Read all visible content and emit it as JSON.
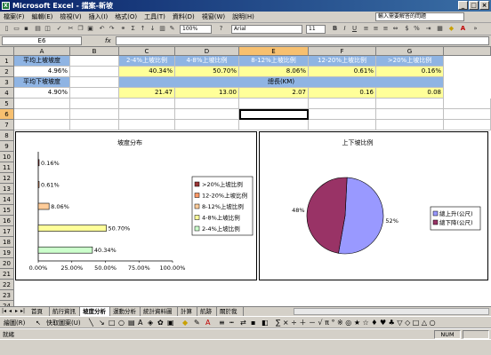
{
  "window": {
    "title": "Microsoft Excel - 擋案-新坡",
    "app_icon": "excel-icon"
  },
  "menu": {
    "items": [
      "檔案(F)",
      "編輯(E)",
      "檢視(V)",
      "插入(I)",
      "格式(O)",
      "工具(T)",
      "資料(D)",
      "視窗(W)",
      "說明(H)"
    ],
    "ask_placeholder": "輸入需要解答的問題"
  },
  "toolbar": {
    "zoom": "100%",
    "font": "Arial",
    "size": "11"
  },
  "formula": {
    "namebox": "E6",
    "fx": "fx"
  },
  "columns": [
    "A",
    "B",
    "C",
    "D",
    "E",
    "F",
    "G"
  ],
  "rows": [
    "1",
    "2",
    "3",
    "4",
    "5",
    "6",
    "7",
    "8",
    "9",
    "10",
    "11",
    "12",
    "13",
    "14",
    "15",
    "16",
    "17",
    "18",
    "19",
    "20",
    "21",
    "22",
    "23",
    "24",
    "25",
    "26"
  ],
  "cells": {
    "a1": "平均上坡坡度",
    "a2": "4.96%",
    "a3": "平均下坡坡度",
    "a4": "4.90%",
    "c1": "2-4%上坡比例",
    "d1": "4-8%上坡比例",
    "e1": "8-12%上坡比例",
    "f1": "12-20%上坡比例",
    "g1": ">20%上坡比例",
    "c2": "40.34%",
    "d2": "50.70%",
    "e2": "8.06%",
    "f2": "0.61%",
    "g2": "0.16%",
    "total_label": "總長(KM)",
    "c4": "21.47",
    "d4": "13.00",
    "e4": "2.07",
    "f4": "0.16",
    "g4": "0.08"
  },
  "chart_data": [
    {
      "type": "bar",
      "title": "坡度分布",
      "categories": [
        "2-4%上坡比例",
        "4-8%上坡比例",
        "8-12%上坡比例",
        "12-20%上坡比例",
        ">20%上坡比例"
      ],
      "values": [
        40.34,
        50.7,
        8.06,
        0.61,
        0.16
      ],
      "labels": [
        "40.34%",
        "50.70%",
        "8.06%",
        "0.61%",
        "0.16%"
      ],
      "colors": [
        "#ccffcc",
        "#ffff99",
        "#ffcc99",
        "#ff9966",
        "#993333"
      ],
      "xticks": [
        "0.00%",
        "25.00%",
        "50.00%",
        "75.00%",
        "100.00%"
      ],
      "xlim": [
        0,
        100
      ],
      "legend": "right",
      "legend_order": [
        ">20%上坡比例",
        "12-20%上坡比例",
        "8-12%上坡比例",
        "4-8%上坡比例",
        "2-4%上坡比例"
      ]
    },
    {
      "type": "pie",
      "title": "上下坡比例",
      "series": [
        {
          "name": "總上升(公尺)",
          "value": 52,
          "label": "52%",
          "color": "#9999ff"
        },
        {
          "name": "總下降(公尺)",
          "value": 48,
          "label": "48%",
          "color": "#993366"
        }
      ],
      "legend": "right"
    }
  ],
  "tabs": [
    "首頁",
    "航行資訊",
    "坡度分析",
    "運動分析",
    "統計資料圖",
    "計算",
    "航跡",
    "關於我"
  ],
  "active_tab": "坡度分析",
  "drawbar": {
    "draw_label": "繪圖(R)",
    "autoshape_label": "快取圖案(U)"
  },
  "status": {
    "left": "就緒",
    "num": "NUM"
  }
}
